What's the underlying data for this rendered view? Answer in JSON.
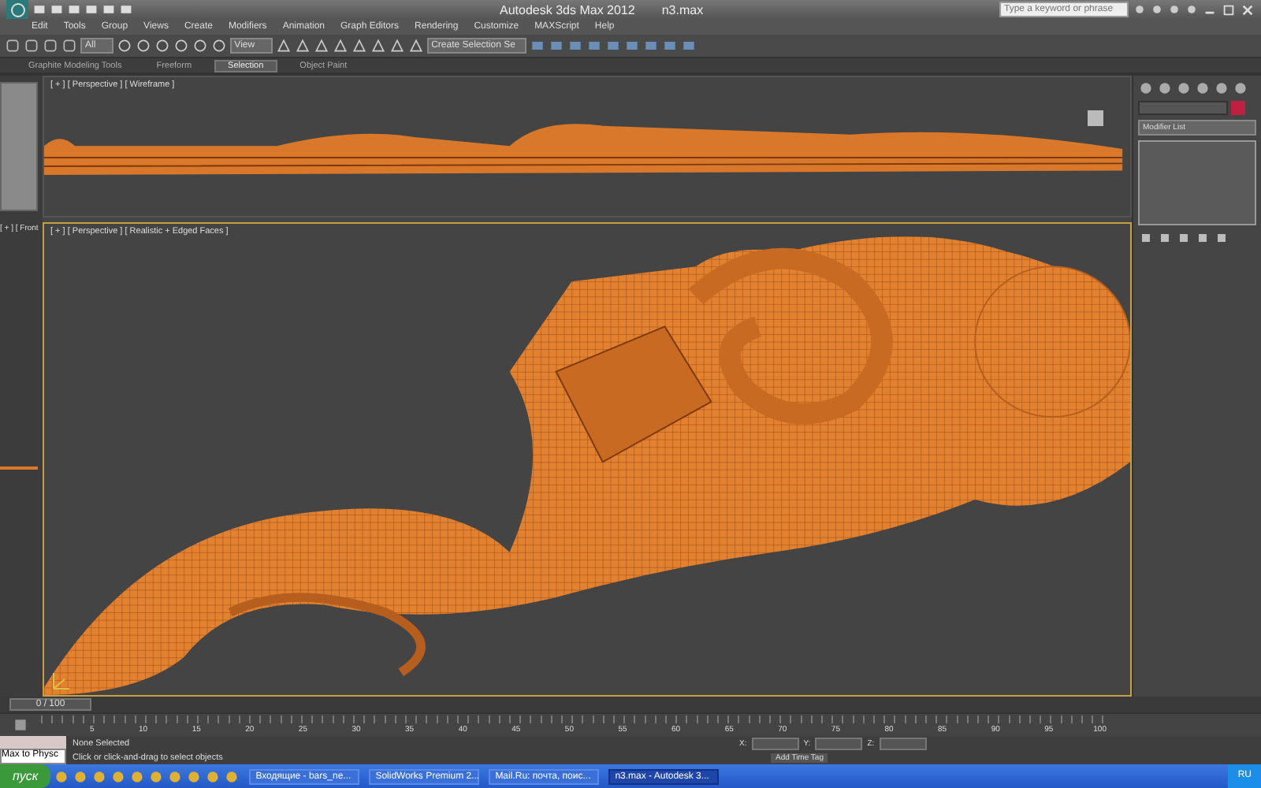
{
  "window": {
    "title": "Autodesk 3ds Max  2012",
    "file": "n3.max",
    "search": {
      "placeholder": "Type a keyword or phrase"
    }
  },
  "menu": [
    "Edit",
    "Tools",
    "Group",
    "Views",
    "Create",
    "Modifiers",
    "Animation",
    "Graph Editors",
    "Rendering",
    "Customize",
    "MAXScript",
    "Help"
  ],
  "toolbar": {
    "selection_filter": "All",
    "reference_coords": "View",
    "named_selection": "Create Selection Se"
  },
  "ribbon_tabs": [
    {
      "label": "Graphite Modeling Tools",
      "selected": false
    },
    {
      "label": "Freeform",
      "selected": false
    },
    {
      "label": "Selection",
      "selected": true
    },
    {
      "label": "Object Paint",
      "selected": false
    }
  ],
  "viewports": {
    "top_label": "[ + ] [ Perspective ] [ Wireframe ]",
    "main_label": "[ + ] [ Perspective ] [ Realistic + Edged Faces ]",
    "side_label": "[ + ] [ Front"
  },
  "command_panel": {
    "modifier_list": "Modifier List"
  },
  "time_slider": {
    "position": "0 / 100"
  },
  "track_ticks": [
    "5",
    "10",
    "15",
    "20",
    "25",
    "30",
    "35",
    "40",
    "45",
    "50",
    "55",
    "60",
    "65",
    "70",
    "75",
    "80",
    "85",
    "90",
    "95",
    "100"
  ],
  "status": {
    "script_listener": "Max to Physc",
    "selection": "None Selected",
    "prompt": "Click or click-and-drag to select objects",
    "x_label": "X:",
    "y_label": "Y:",
    "z_label": "Z:",
    "time_tag": "Add Time Tag"
  },
  "taskbar": {
    "start": "пуск",
    "tasks": [
      {
        "label": "Входящие - bars_ne...",
        "selected": false
      },
      {
        "label": "SolidWorks Premium 2...",
        "selected": false
      },
      {
        "label": "Mail.Ru: почта, поис...",
        "selected": false
      },
      {
        "label": "n3.max - Autodesk 3...",
        "selected": true
      }
    ],
    "language": "RU"
  }
}
